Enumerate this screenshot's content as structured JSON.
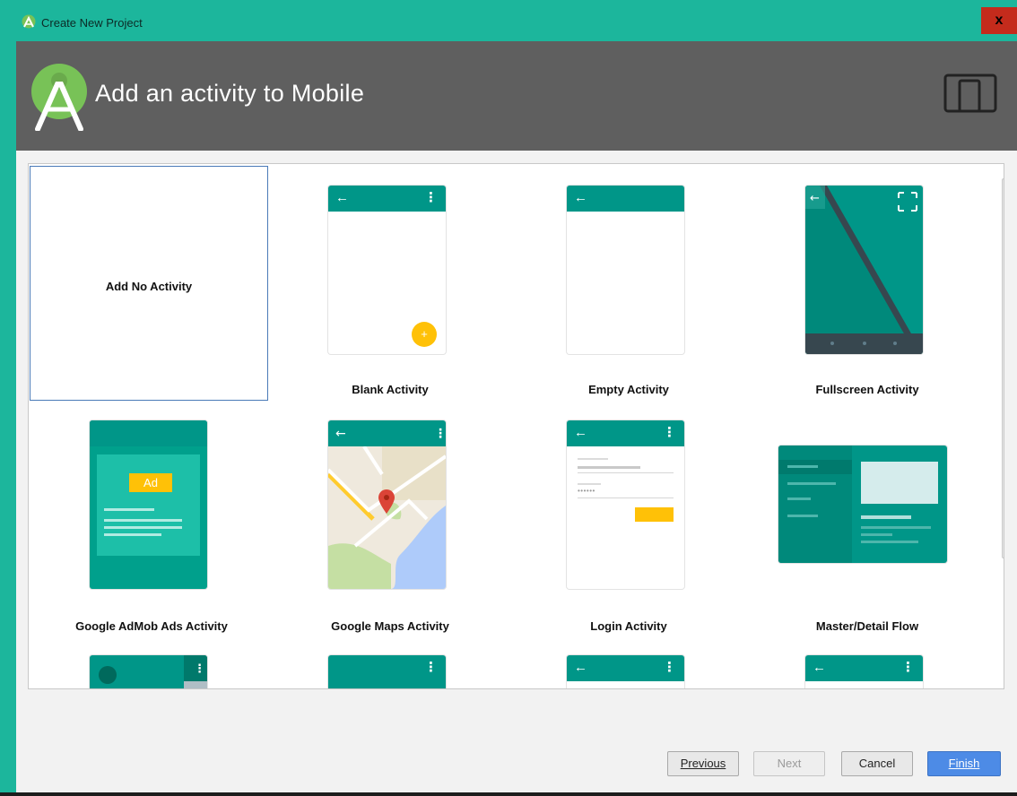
{
  "window": {
    "title": "Create New Project",
    "close_label": "x"
  },
  "header": {
    "heading": "Add an activity to Mobile"
  },
  "gallery": {
    "tiles": [
      {
        "label": "Add No Activity"
      },
      {
        "label": "Blank Activity"
      },
      {
        "label": "Empty Activity"
      },
      {
        "label": "Fullscreen Activity"
      },
      {
        "label": "Google AdMob Ads Activity",
        "badge": "Ad"
      },
      {
        "label": "Google Maps Activity"
      },
      {
        "label": "Login Activity",
        "password_mask": "••••••"
      },
      {
        "label": "Master/Detail Flow"
      }
    ]
  },
  "buttons": {
    "previous": "Previous",
    "next": "Next",
    "cancel": "Cancel",
    "finish": "Finish"
  },
  "colors": {
    "titlebar": "#1cb69c",
    "header": "#5f5f5f",
    "accent": "#009688",
    "fab": "#ffc107",
    "primary_button": "#4d8be6"
  }
}
